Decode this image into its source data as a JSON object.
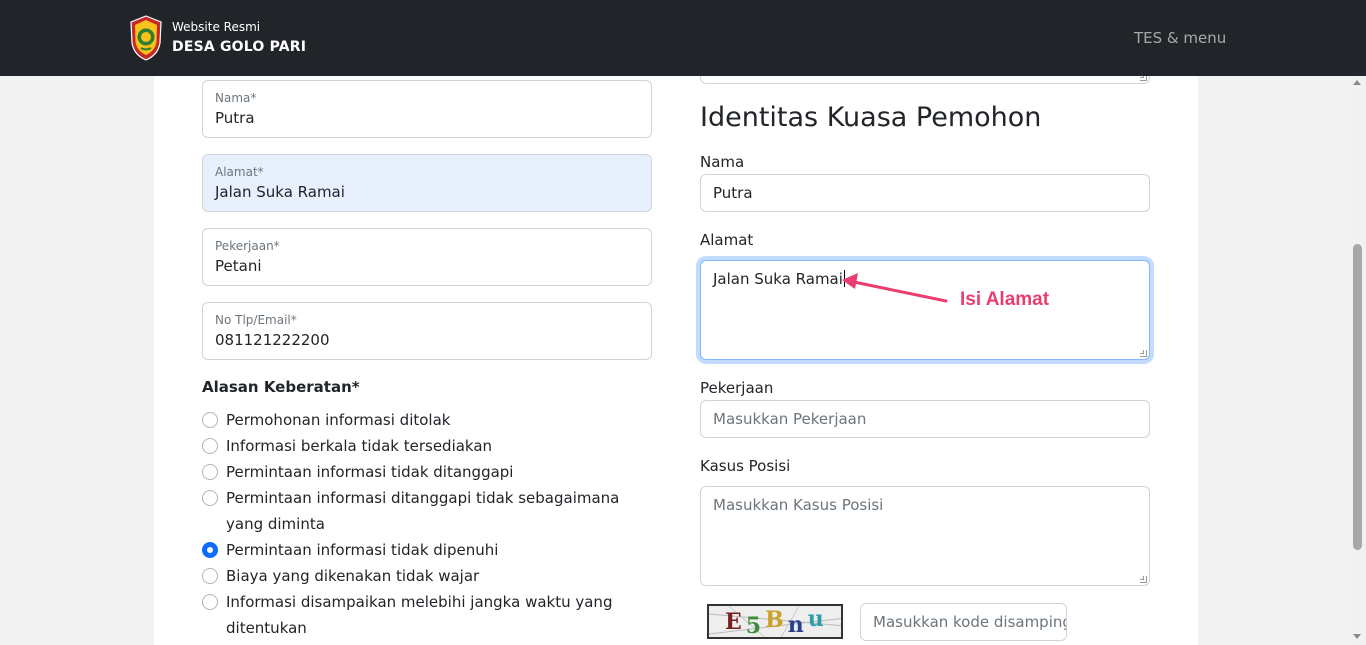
{
  "navbar": {
    "brand_small": "Website Resmi",
    "brand_big": "DESA GOLO PARI",
    "menu_label": "TES & menu"
  },
  "left": {
    "nama": {
      "label": "Nama*",
      "value": "Putra"
    },
    "alamat": {
      "label": "Alamat*",
      "value": "Jalan Suka Ramai"
    },
    "pekerjaan": {
      "label": "Pekerjaan*",
      "value": "Petani"
    },
    "kontak": {
      "label": "No Tlp/Email*",
      "value": "081121222200"
    },
    "alasan_title": "Alasan Keberatan*",
    "alasan_options": [
      {
        "label": "Permohonan informasi ditolak",
        "checked": false
      },
      {
        "label": "Informasi berkala tidak tersediakan",
        "checked": false
      },
      {
        "label": "Permintaan informasi tidak ditanggapi",
        "checked": false
      },
      {
        "label": "Permintaan informasi ditanggapi tidak sebagaimana yang diminta",
        "checked": false
      },
      {
        "label": "Permintaan informasi tidak dipenuhi",
        "checked": true
      },
      {
        "label": "Biaya yang dikenakan tidak wajar",
        "checked": false
      },
      {
        "label": "Informasi disampaikan melebihi jangka waktu yang ditentukan",
        "checked": false
      }
    ]
  },
  "right": {
    "section_title": "Identitas Kuasa Pemohon",
    "nama_label": "Nama",
    "nama_value": "Putra",
    "alamat_label": "Alamat",
    "alamat_value": "Jalan Suka Ramai",
    "pekerjaan_label": "Pekerjaan",
    "pekerjaan_placeholder": "Masukkan Pekerjaan",
    "kasus_label": "Kasus Posisi",
    "kasus_placeholder": "Masukkan Kasus Posisi",
    "captcha_text": "E5Bnu",
    "captcha_placeholder": "Masukkan kode disamping"
  },
  "annotation": {
    "text": "Isi Alamat",
    "color": "#ea3e6e"
  },
  "colors": {
    "navbar": "#212529",
    "primary": "#0d6efd",
    "autofill": "#e8f0fe"
  }
}
